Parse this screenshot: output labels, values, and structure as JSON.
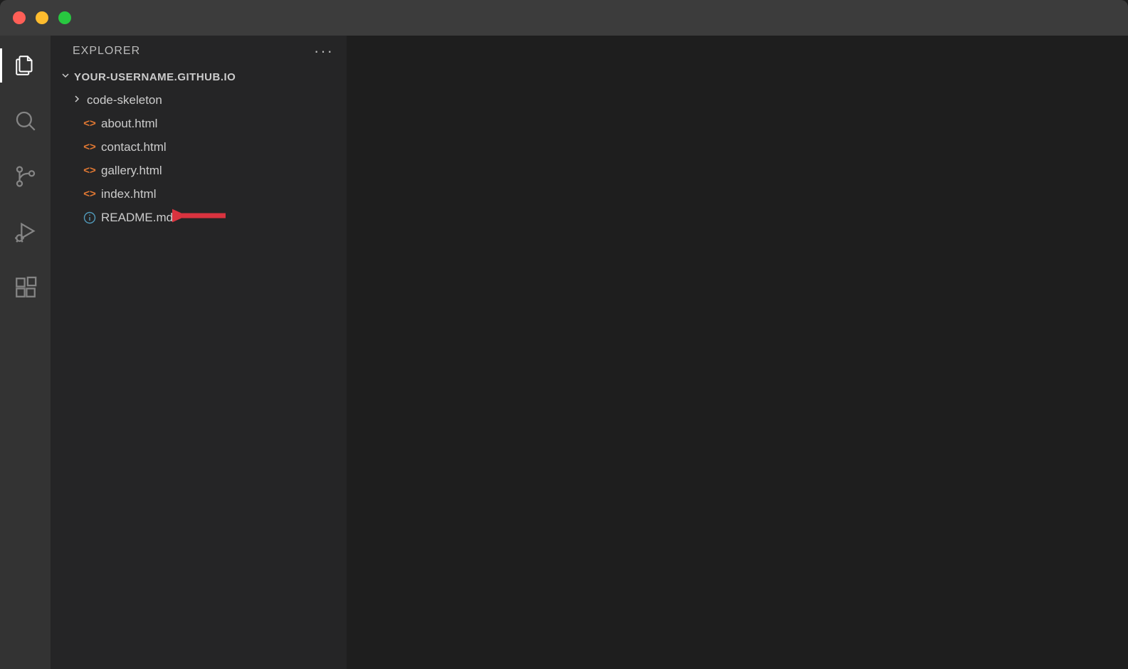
{
  "sidebar": {
    "title": "EXPLORER",
    "root_folder": "YOUR-USERNAME.GITHUB.IO",
    "items": [
      {
        "type": "folder",
        "name": "code-skeleton",
        "icon": "chevron"
      },
      {
        "type": "file",
        "name": "about.html",
        "icon": "html"
      },
      {
        "type": "file",
        "name": "contact.html",
        "icon": "html"
      },
      {
        "type": "file",
        "name": "gallery.html",
        "icon": "html",
        "highlighted": true
      },
      {
        "type": "file",
        "name": "index.html",
        "icon": "html"
      },
      {
        "type": "file",
        "name": "README.md",
        "icon": "info"
      }
    ]
  },
  "colors": {
    "html_icon": "#e37933",
    "info_icon": "#519aba",
    "annotation": "#d9333f"
  }
}
